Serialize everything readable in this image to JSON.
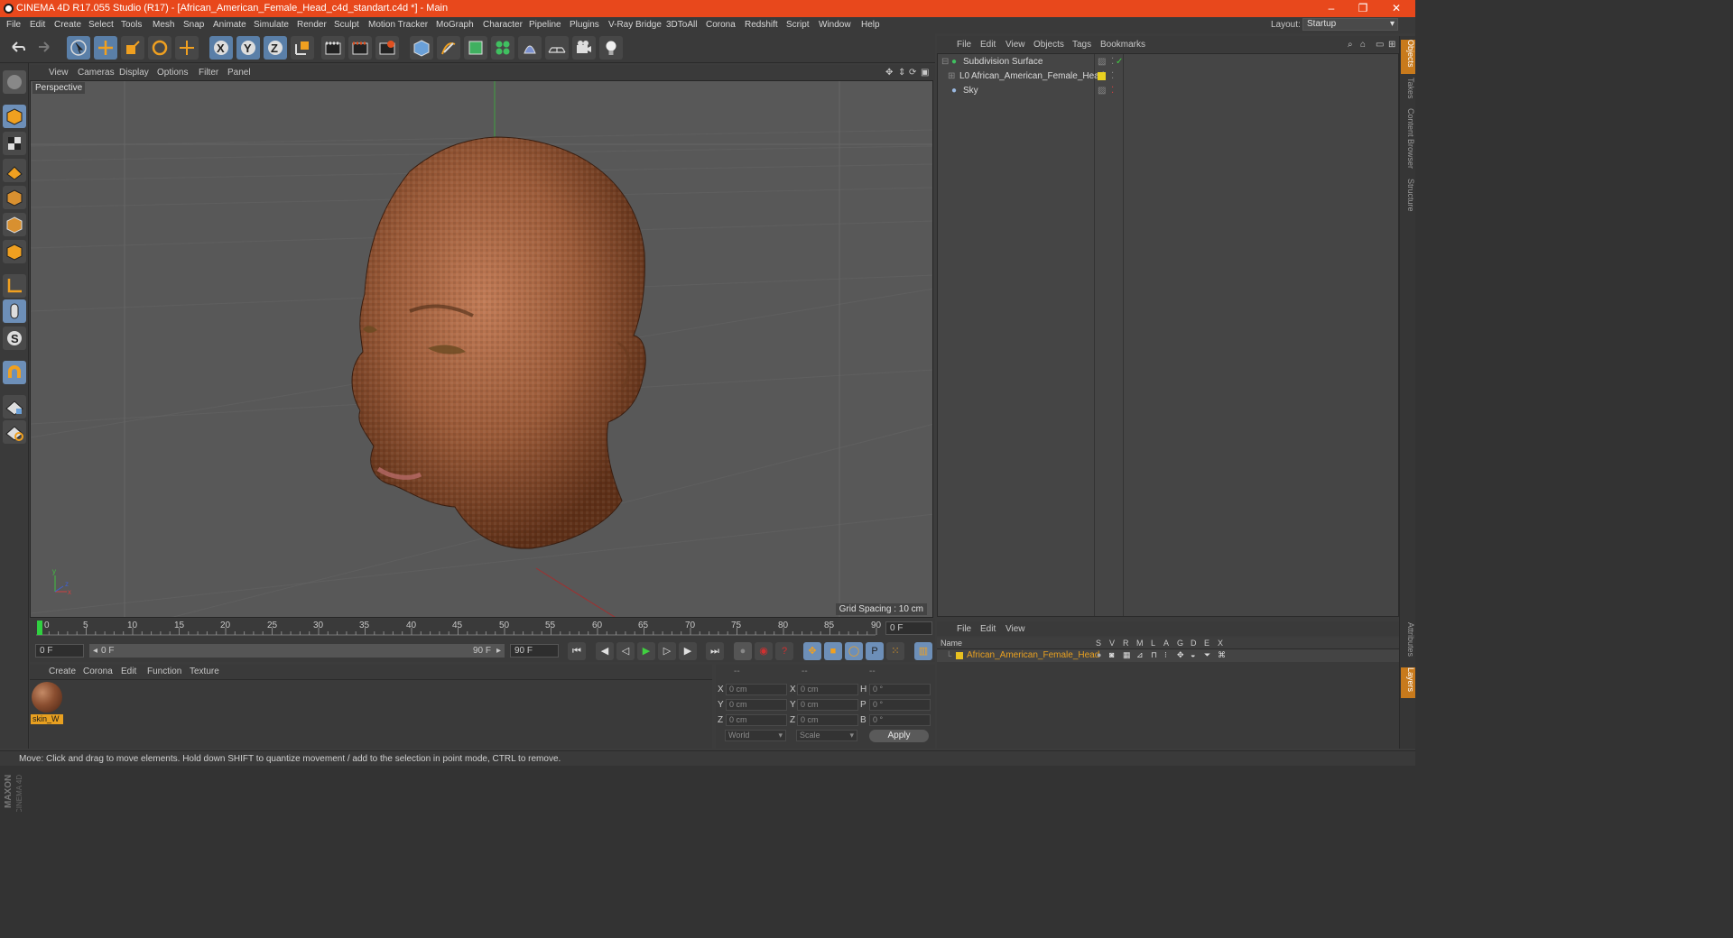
{
  "titlebar": {
    "title": "CINEMA 4D R17.055 Studio (R17) - [African_American_Female_Head_c4d_standart.c4d *] - Main",
    "minimize": "–",
    "restore": "❐",
    "close": "✕"
  },
  "menubar": {
    "items": [
      "File",
      "Edit",
      "Create",
      "Select",
      "Tools",
      "Mesh",
      "Snap",
      "Animate",
      "Simulate",
      "Render",
      "Sculpt",
      "Motion Tracker",
      "MoGraph",
      "Character",
      "Pipeline",
      "Plugins",
      "V-Ray Bridge",
      "3DToAll",
      "Corona",
      "Redshift",
      "Script",
      "Window",
      "Help"
    ],
    "layout_label": "Layout:",
    "layout_value": "Startup"
  },
  "viewport": {
    "menu": [
      "View",
      "Cameras",
      "Display",
      "Options",
      "Filter",
      "Panel"
    ],
    "label": "Perspective",
    "grid_spacing": "Grid Spacing : 10 cm"
  },
  "timeline": {
    "ticks": [
      "0",
      "5",
      "10",
      "15",
      "20",
      "25",
      "30",
      "35",
      "40",
      "45",
      "50",
      "55",
      "60",
      "65",
      "70",
      "75",
      "80",
      "85",
      "90"
    ],
    "current_frame": "0 F"
  },
  "transport": {
    "start_field": "0 F",
    "range_start": "0 F",
    "range_end": "90 F",
    "end_field": "90 F"
  },
  "material_manager": {
    "menu": [
      "Create",
      "Corona",
      "Edit",
      "Function",
      "Texture"
    ],
    "materials": [
      {
        "name": "skin_W"
      }
    ]
  },
  "coordinates": {
    "headers": [
      "--",
      "--",
      "--"
    ],
    "rows": [
      {
        "axis": "X",
        "pos": "0 cm",
        "axis2": "X",
        "size": "0 cm",
        "rot_label": "H",
        "rot": "0 °"
      },
      {
        "axis": "Y",
        "pos": "0 cm",
        "axis2": "Y",
        "size": "0 cm",
        "rot_label": "P",
        "rot": "0 °"
      },
      {
        "axis": "Z",
        "pos": "0 cm",
        "axis2": "Z",
        "size": "0 cm",
        "rot_label": "B",
        "rot": "0 °"
      }
    ],
    "mode_select": "World",
    "scale_select": "Scale",
    "apply_label": "Apply"
  },
  "object_manager": {
    "menu": [
      "File",
      "Edit",
      "View",
      "Objects",
      "Tags",
      "Bookmarks"
    ],
    "objects": [
      {
        "name": "Subdivision Surface"
      },
      {
        "name": "African_American_Female_Head"
      },
      {
        "name": "Sky"
      }
    ]
  },
  "layer_manager": {
    "menu": [
      "File",
      "Edit",
      "View"
    ],
    "name_header": "Name",
    "columns": [
      "S",
      "V",
      "R",
      "M",
      "L",
      "A",
      "G",
      "D",
      "E",
      "X"
    ],
    "layers": [
      {
        "name": "African_American_Female_Head",
        "color": "#e8c020"
      }
    ]
  },
  "right_tabs": [
    "Objects",
    "Takes",
    "Content Browser",
    "Structure",
    "Attributes",
    "Layers"
  ],
  "statusbar": {
    "text": "Move: Click and drag to move elements. Hold down SHIFT to quantize movement / add to the selection in point mode, CTRL to remove."
  },
  "logo": {
    "line1": "MAXON",
    "line2": "CINEMA 4D"
  },
  "colors": {
    "titlebar": "#e8481c",
    "accent_blue": "#6d8fb8",
    "selection_orange": "#e8a020",
    "play_green": "#40d040",
    "record_red": "#d03030"
  }
}
